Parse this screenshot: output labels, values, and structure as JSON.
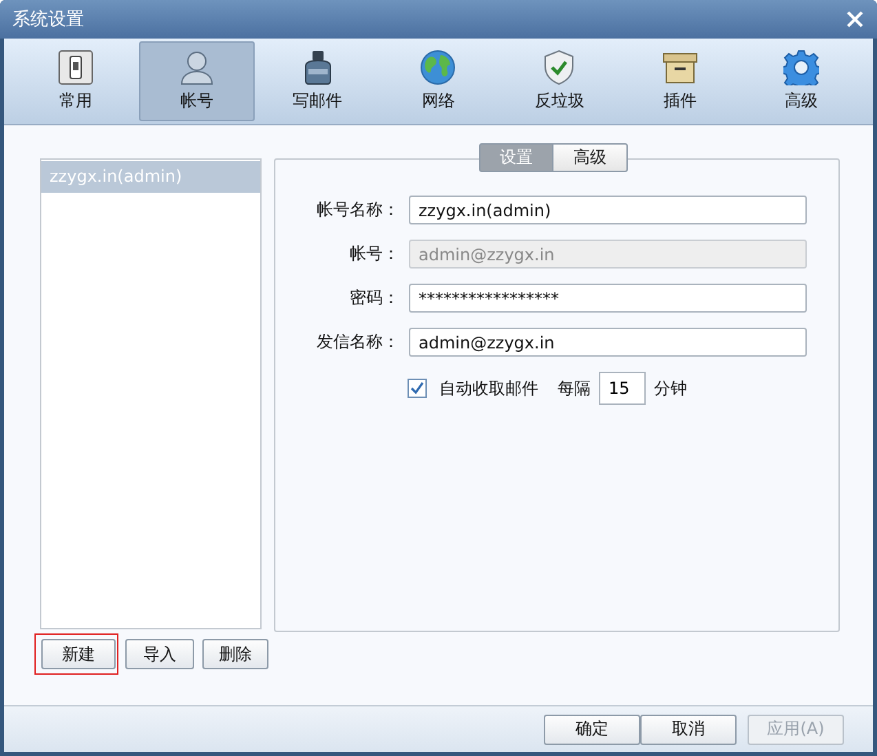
{
  "window": {
    "title": "系统设置"
  },
  "toolbar": [
    {
      "label": "常用",
      "selected": false
    },
    {
      "label": "帐号",
      "selected": true
    },
    {
      "label": "写邮件",
      "selected": false
    },
    {
      "label": "网络",
      "selected": false
    },
    {
      "label": "反垃圾",
      "selected": false
    },
    {
      "label": "插件",
      "selected": false
    },
    {
      "label": "高级",
      "selected": false
    }
  ],
  "accounts": [
    {
      "name": "zzygx.in(admin)",
      "selected": true
    }
  ],
  "account_buttons": [
    {
      "label": "新建",
      "highlighted": true
    },
    {
      "label": "导入",
      "highlighted": false
    },
    {
      "label": "删除",
      "highlighted": false
    }
  ],
  "tabs": [
    {
      "label": "设置",
      "selected": true
    },
    {
      "label": "高级",
      "selected": false
    }
  ],
  "fields": [
    {
      "label": "帐号名称：",
      "value": "zzygx.in(admin)",
      "disabled": false
    },
    {
      "label": "帐号：",
      "value": "admin@zzygx.in",
      "disabled": true
    },
    {
      "label": "密码：",
      "value": "*****************",
      "disabled": false
    },
    {
      "label": "发信名称：",
      "value": "admin@zzygx.in",
      "disabled": false
    }
  ],
  "auto_fetch": {
    "label": "自动收取邮件",
    "checked": true,
    "prefix": "每隔",
    "interval": "15",
    "unit": "分钟"
  },
  "footer_buttons": [
    {
      "label": "确定",
      "disabled": false
    },
    {
      "label": "取消",
      "disabled": false
    },
    {
      "label": "应用(A)",
      "disabled": true
    }
  ]
}
